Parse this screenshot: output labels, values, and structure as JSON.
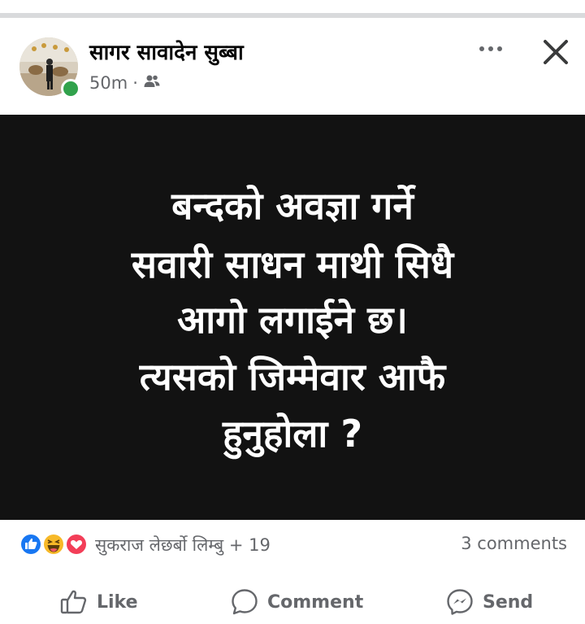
{
  "post": {
    "author": "सागर सावादेन सुब्बा",
    "time": "50m",
    "separator": "·",
    "audience_icon": "friends-icon",
    "lines": [
      "बन्दको अवज्ञा गर्ने",
      "सवारी साधन माथी सिधै",
      "आगो लगाईने छ।",
      "त्यसको जिम्मेवार आफै",
      "हुनुहोला ?"
    ]
  },
  "reactions": {
    "icons": [
      "like-reaction-icon",
      "haha-reaction-icon",
      "love-reaction-icon"
    ],
    "summary": "सुकराज लेछर्बो लिम्बु + 19",
    "comments": "3 comments"
  },
  "actions": {
    "like": "Like",
    "comment": "Comment",
    "send": "Send"
  },
  "colors": {
    "online": "#31a24c",
    "like_blue": "#1877f2",
    "love_red": "#f33e58",
    "haha_yellow": "#f7b928",
    "post_bg": "#121212",
    "secondary_text": "#65676b"
  }
}
